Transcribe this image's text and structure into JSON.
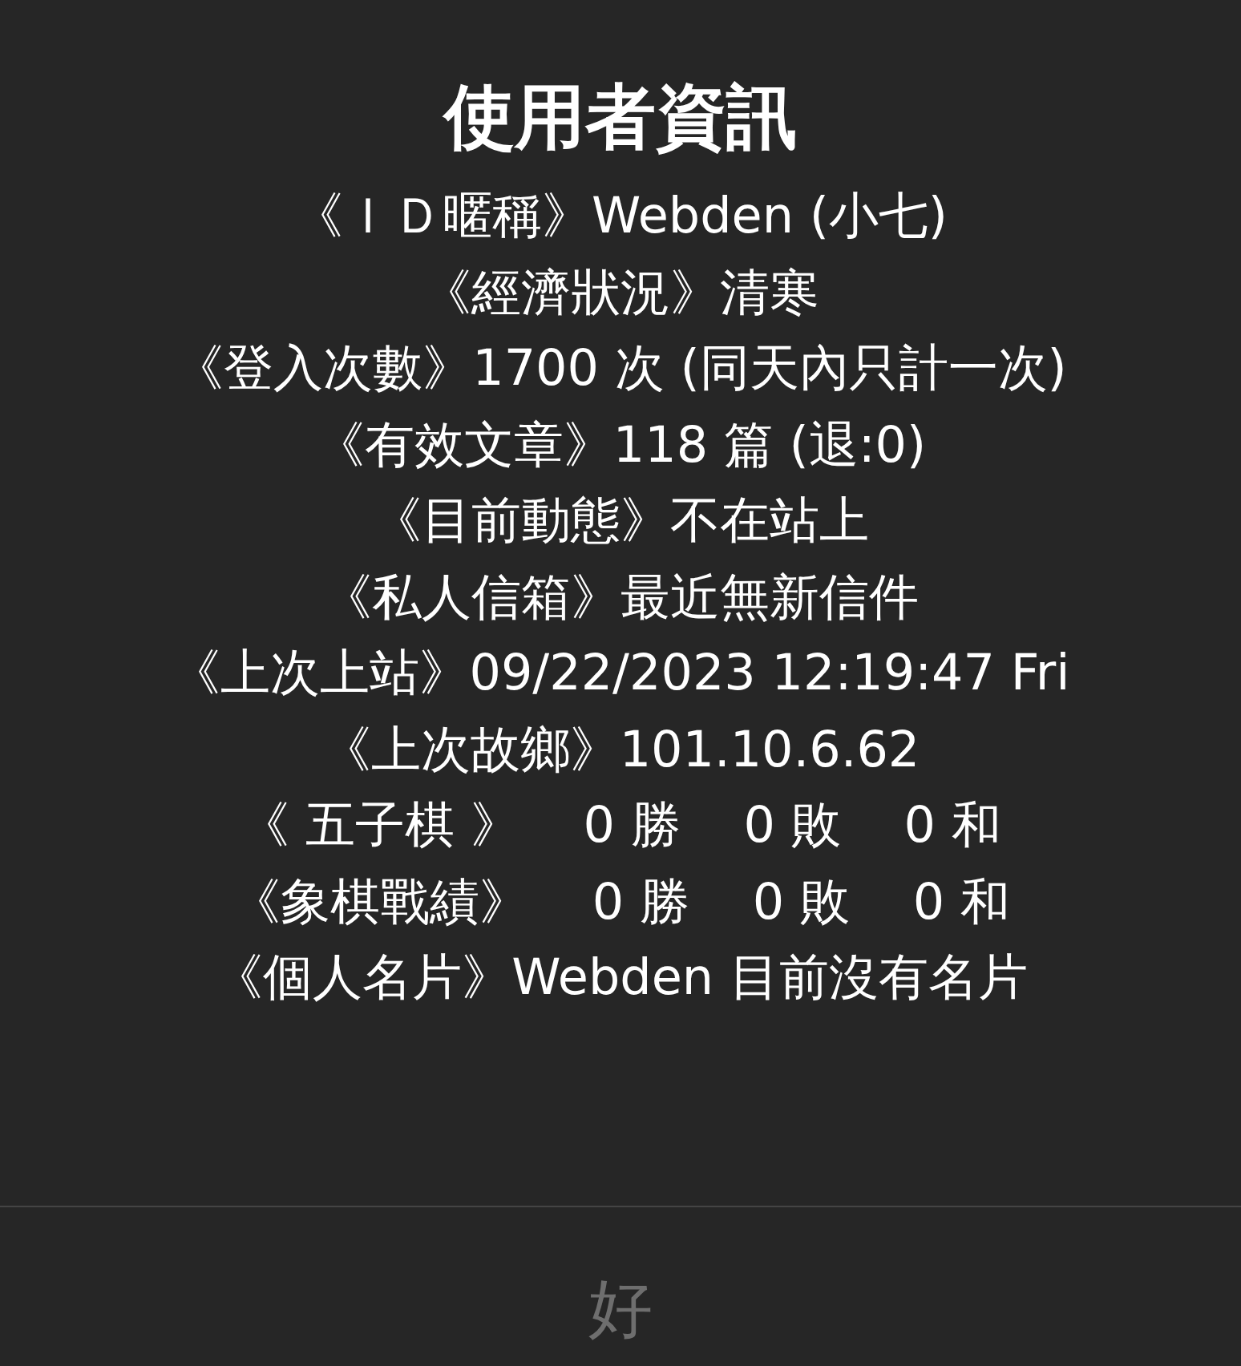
{
  "dialog": {
    "title": "使用者資訊",
    "lines": [
      "《ＩＤ暱稱》Webden (小七)",
      "《經濟狀況》清寒",
      "《登入次數》1700 次 (同天內只計一次)",
      "《有效文章》118 篇 (退:0)",
      "《目前動態》不在站上",
      "《私人信箱》最近無新信件",
      "《上次上站》09/22/2023 12:19:47 Fri",
      "《上次故鄉》101.10.6.62",
      "《 五子棋 》    0 勝    0 敗    0 和",
      "《象棋戰績》    0 勝    0 敗    0 和",
      "《個人名片》Webden 目前沒有名片"
    ],
    "buttons": [
      {
        "label": "好",
        "disabled": true
      }
    ]
  }
}
